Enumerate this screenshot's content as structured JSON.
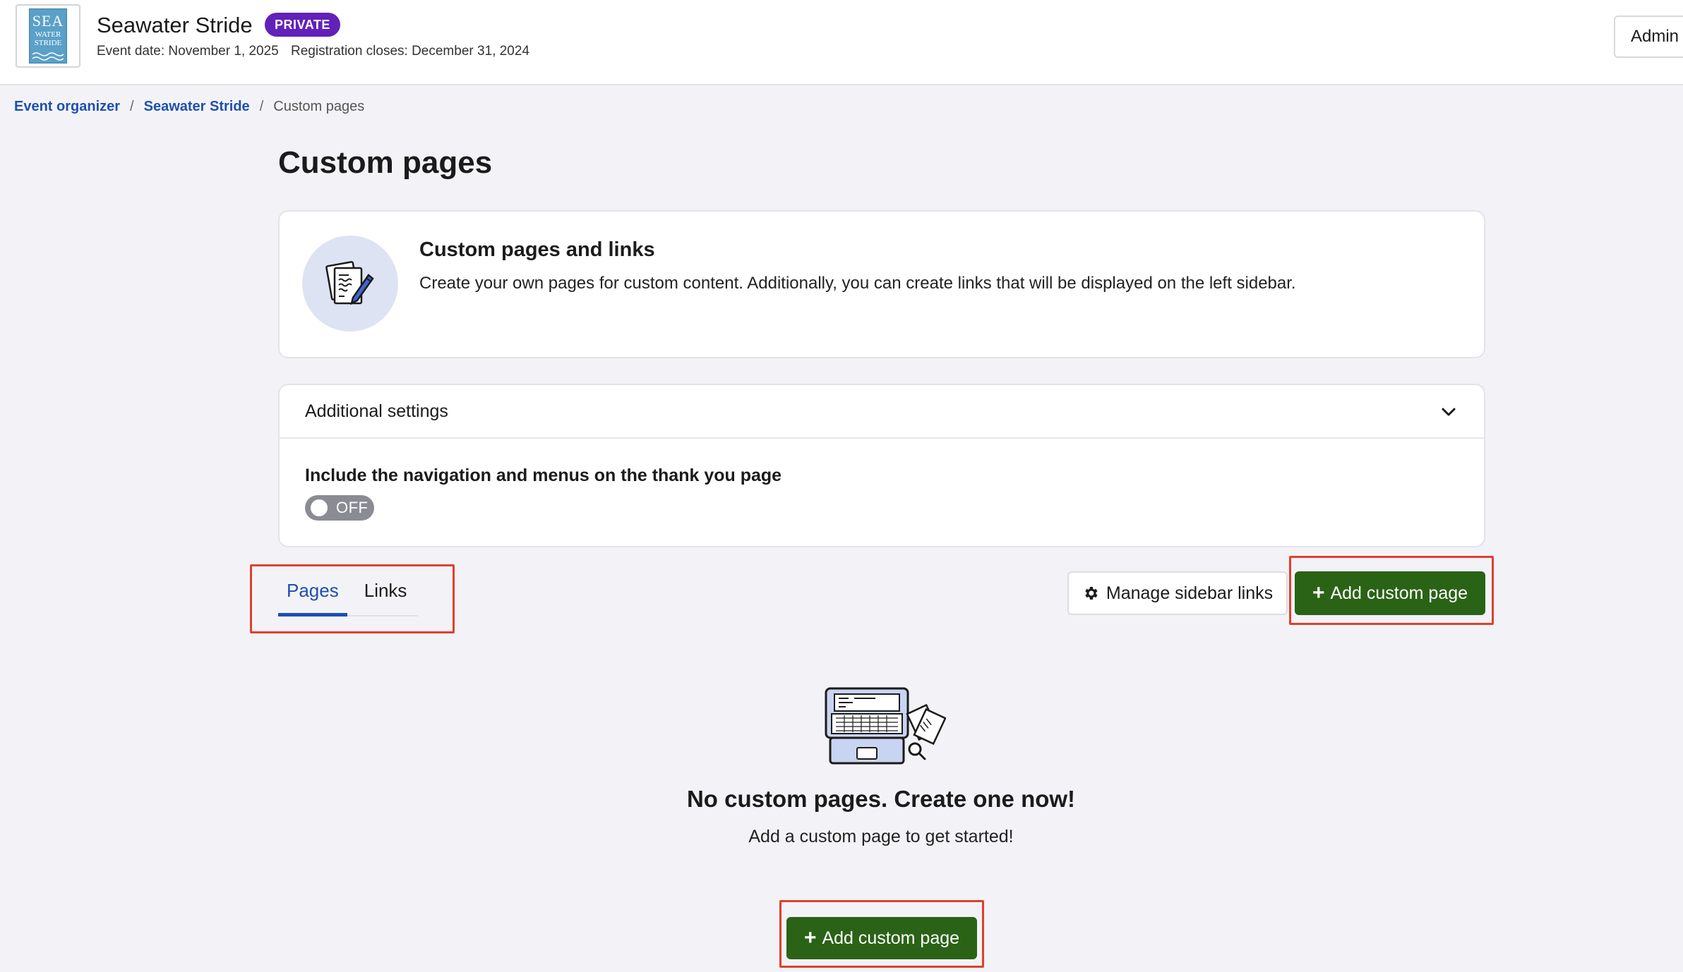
{
  "header": {
    "logo": {
      "line1": "SEA",
      "line2": "WATER",
      "line3": "STRIDE"
    },
    "event_title": "Seawater Stride",
    "privacy_badge": "PRIVATE",
    "event_date": "Event date: November 1, 2025",
    "registration_closes": "Registration closes: December 31, 2024",
    "admin_button": "Admin"
  },
  "breadcrumb": {
    "items": [
      "Event organizer",
      "Seawater Stride"
    ],
    "separator": "/",
    "current": "Custom pages"
  },
  "page_title": "Custom pages",
  "info_card": {
    "icon": "document-pencil-icon",
    "heading": "Custom pages and links",
    "description": "Create your own pages for custom content. Additionally, you can create links that will be displayed on the left sidebar."
  },
  "settings": {
    "header": "Additional settings",
    "expanded": true,
    "option_label": "Include the navigation and menus on the thank you page",
    "toggle_state": "OFF"
  },
  "tabs": [
    {
      "label": "Pages",
      "active": true
    },
    {
      "label": "Links",
      "active": false
    }
  ],
  "actions": {
    "manage_sidebar_links": "Manage sidebar links",
    "add_custom_page": "Add custom page"
  },
  "empty_state": {
    "illustration": "laptop-documents-icon",
    "title": "No custom pages. Create one now!",
    "subtitle": "Add a custom page to get started!",
    "button": "Add custom page"
  },
  "colors": {
    "accent_blue": "#1f4fb0",
    "primary_green": "#2a6316",
    "private_badge": "#6221b8",
    "highlight_red": "#e0402c",
    "background": "#f3f3f7"
  }
}
